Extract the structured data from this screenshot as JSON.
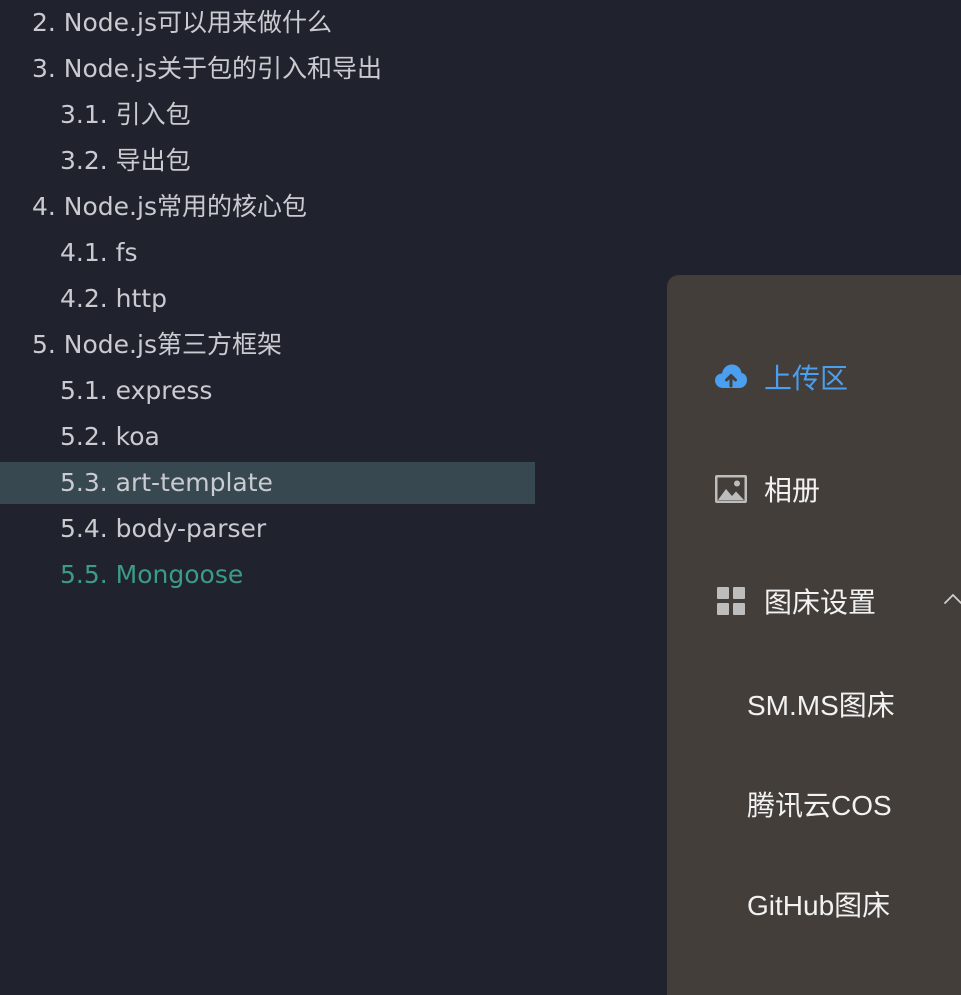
{
  "toc": {
    "items": [
      {
        "label": "2. Node.js可以用来做什么"
      },
      {
        "label": "3. Node.js关于包的引入和导出"
      },
      {
        "label": "3.1. 引入包"
      },
      {
        "label": "3.2. 导出包"
      },
      {
        "label": "4. Node.js常用的核心包"
      },
      {
        "label": "4.1. fs"
      },
      {
        "label": "4.2. http"
      },
      {
        "label": "5. Node.js第三方框架"
      },
      {
        "label": "5.1. express"
      },
      {
        "label": "5.2. koa"
      },
      {
        "label": "5.3. art-template"
      },
      {
        "label": "5.4. body-parser"
      },
      {
        "label": "5.5. Mongoose"
      }
    ]
  },
  "menu": {
    "upload": {
      "label": "上传区",
      "icon": "cloud-upload-icon"
    },
    "album": {
      "label": "相册",
      "icon": "image-icon"
    },
    "settings": {
      "label": "图床设置",
      "icon": "grid-icon",
      "expanded": true,
      "children": [
        {
          "label": "SM.MS图床"
        },
        {
          "label": "腾讯云COS"
        },
        {
          "label": "GitHub图床"
        }
      ]
    }
  },
  "colors": {
    "background": "#20232d",
    "toc_text": "#c9cbd0",
    "toc_active_bg": "#384850",
    "toc_current": "#3c9b88",
    "panel_bg": "#433e39",
    "accent_blue": "#4a9ff0"
  }
}
